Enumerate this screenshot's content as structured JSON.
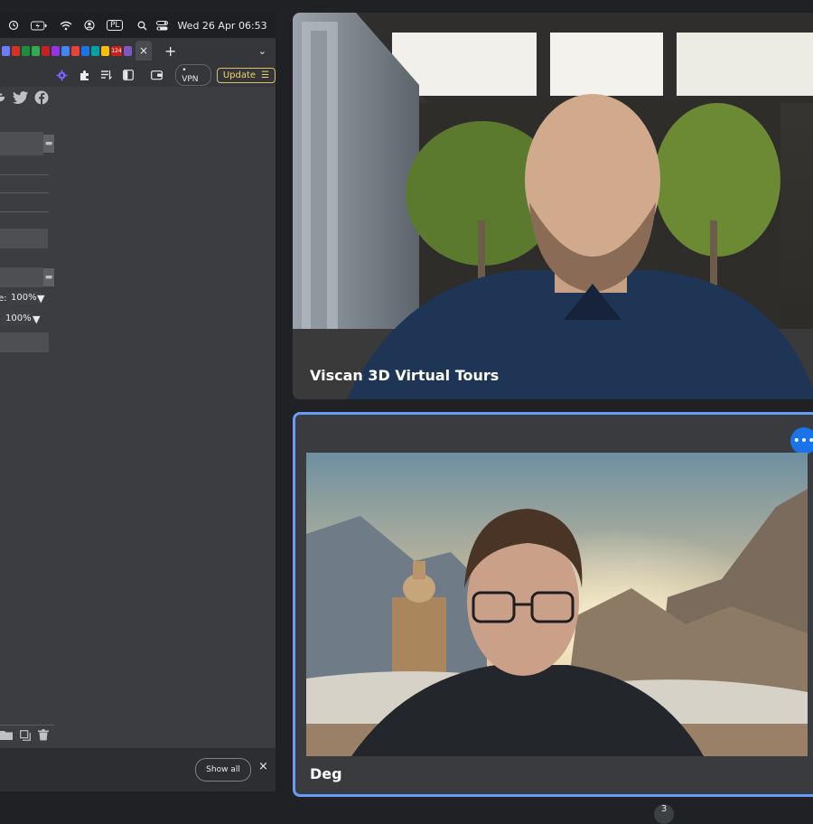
{
  "menubar": {
    "input_label": "PL",
    "datetime": "Wed 26 Apr  06:53"
  },
  "browser": {
    "tab_close_glyph": "×",
    "new_tab_glyph": "+",
    "tab_menu_glyph": "⌄",
    "vpn_label": "VPN",
    "update_label": "Update",
    "update_menu_glyph": "☰",
    "tab_favicon_colors": [
      "#6c7cff",
      "#d93025",
      "#1e8e3e",
      "#34a853",
      "#c5221f",
      "#9334e6",
      "#4285f4",
      "#ea4335",
      "#1a73e8",
      "#00a4a6",
      "#fbbc04",
      "#c5221f",
      "#7e57c2"
    ],
    "tab_badge_number": "124"
  },
  "left_page": {
    "zoom_label_1": "e:",
    "zoom_value_1": "100%",
    "zoom_value_2": "100%",
    "caret": "▼",
    "mini_btn_glyph": "▬"
  },
  "downloads_bar": {
    "show_all_label": "Show all",
    "close_glyph": "×"
  },
  "tiles": [
    {
      "name": "Viscan 3D Virtual Tours"
    },
    {
      "name": "Deg",
      "more_glyph": "•••"
    }
  ],
  "badge": {
    "count": "3"
  },
  "colors": {
    "active_speaker_border": "#669df6",
    "more_button": "#1a73e8",
    "update_accent": "#f1d36b"
  }
}
